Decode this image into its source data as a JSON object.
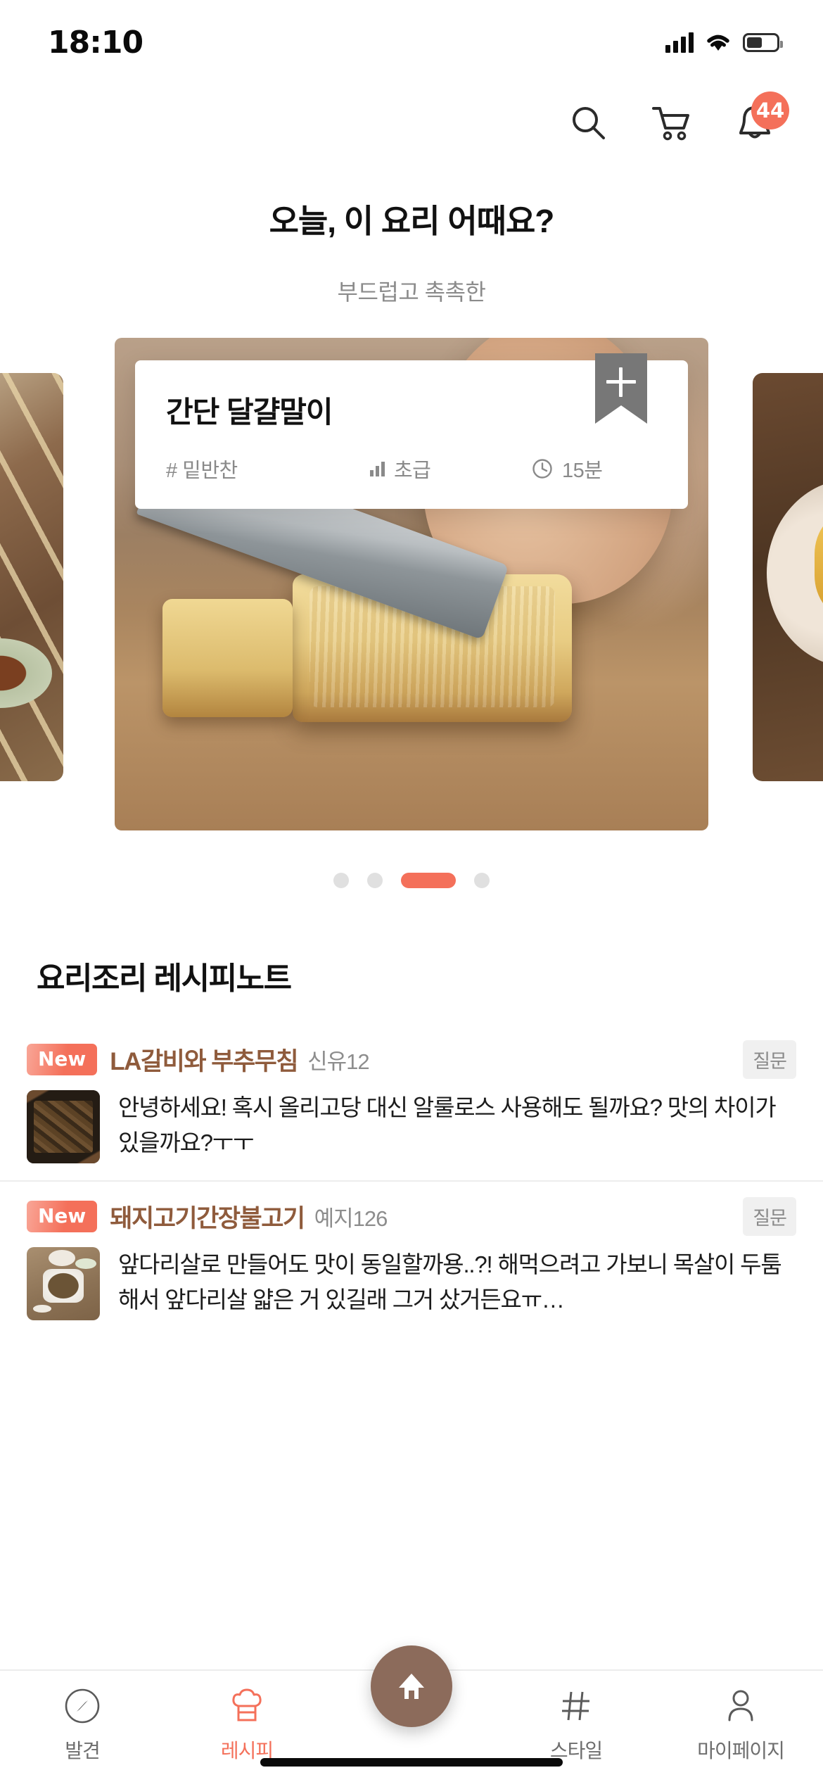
{
  "status_bar": {
    "time": "18:10"
  },
  "header": {
    "search_icon": "search-icon",
    "cart_icon": "cart-icon",
    "bell_icon": "bell-icon",
    "notification_count": "44"
  },
  "hero": {
    "title": "오늘, 이 요리 어때요?",
    "subtitle": "부드럽고 촉촉한"
  },
  "featured_card": {
    "title": "간단 달걀말이",
    "category": "# 밑반찬",
    "difficulty": "초급",
    "time": "15분",
    "bookmark_label": "+"
  },
  "carousel": {
    "total_dots": 4,
    "active_index": 2
  },
  "section": {
    "title": "요리조리 레시피노트"
  },
  "notes": [
    {
      "badge": "New",
      "title": "LA갈비와 부추무침",
      "author": "신유12",
      "tag": "질문",
      "body": "안녕하세요! 혹시 올리고당 대신 알룰로스 사용해도 될까요? 맛의 차이가 있을까요?ㅜㅜ"
    },
    {
      "badge": "New",
      "title": "돼지고기간장불고기",
      "author": "예지126",
      "tag": "질문",
      "body": "앞다리살로 만들어도 맛이 동일할까용..?! 해먹으려고 가보니 목살이 두툼해서 앞다리살 얇은 거 있길래 그거 샀거든요ㅠ…"
    }
  ],
  "tabbar": {
    "items": [
      {
        "label": "발견",
        "icon": "compass-icon",
        "active": false
      },
      {
        "label": "레시피",
        "icon": "chef-hat-icon",
        "active": true
      },
      {
        "label": "스타일",
        "icon": "hash-icon",
        "active": false
      },
      {
        "label": "마이페이지",
        "icon": "person-icon",
        "active": false
      }
    ],
    "home_icon": "home-icon"
  },
  "colors": {
    "accent": "#F4705A",
    "fab": "#8C6B5B",
    "title_brown": "#8F5B3C"
  }
}
